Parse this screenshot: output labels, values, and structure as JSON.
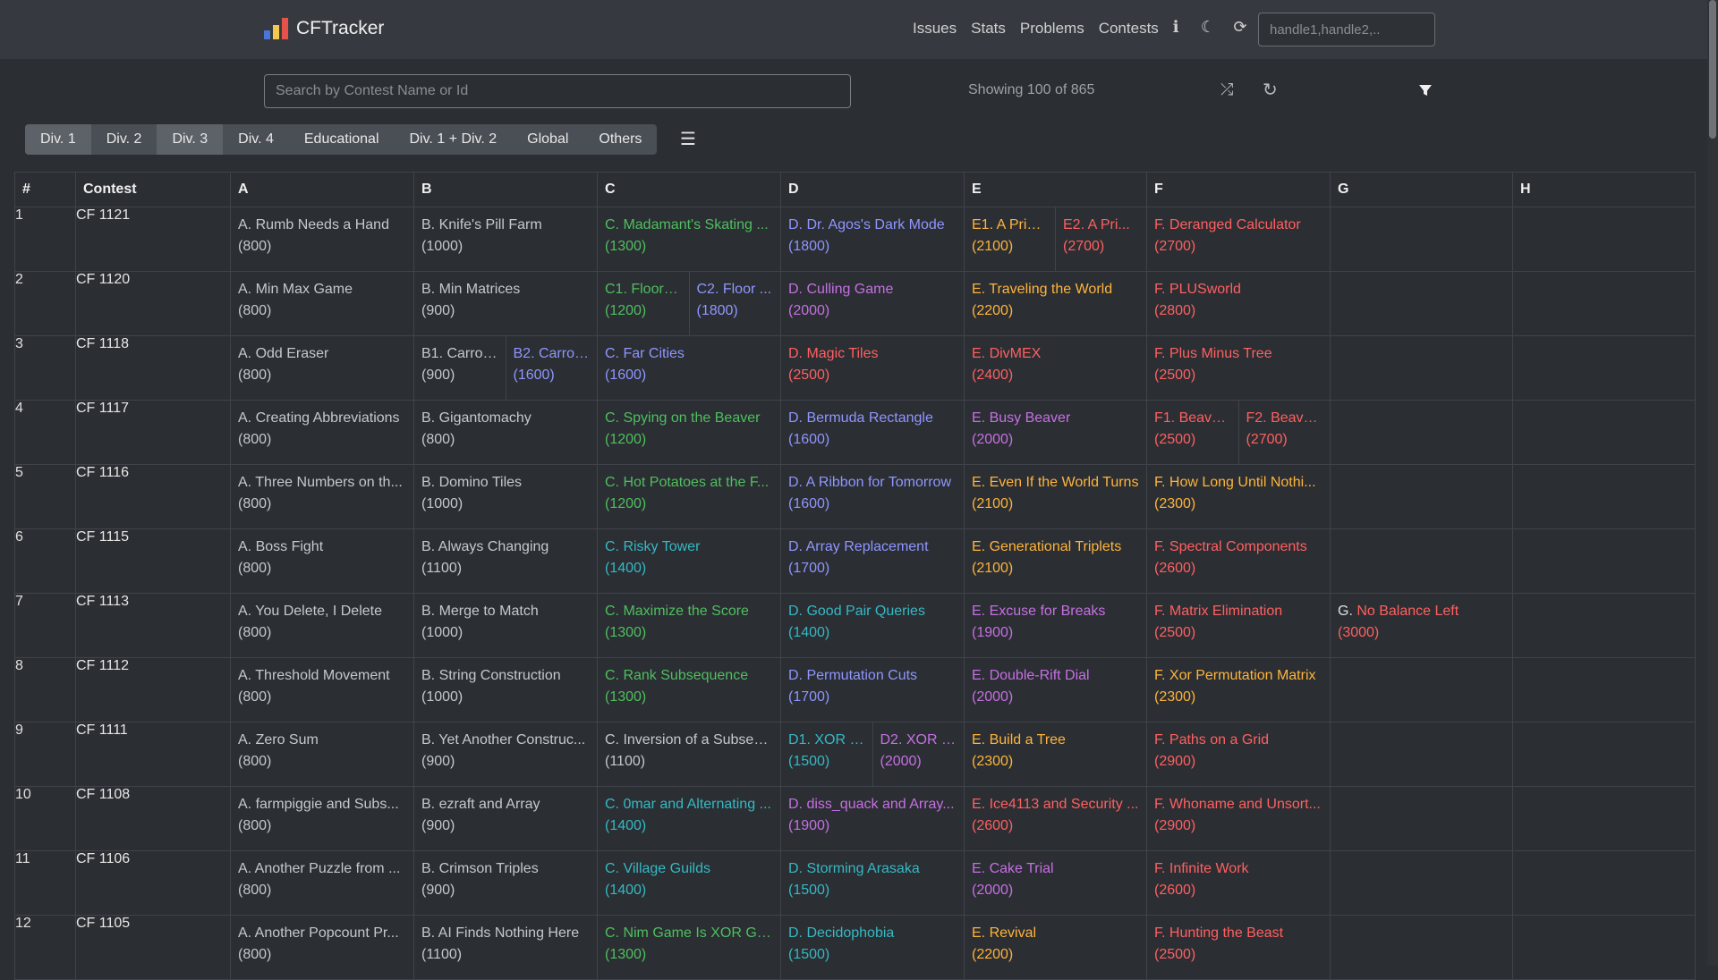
{
  "navbar": {
    "brand": "CFTracker",
    "links": [
      "Issues",
      "Stats",
      "Problems",
      "Contests"
    ],
    "handle_placeholder": "handle1,handle2,.."
  },
  "search": {
    "placeholder": "Search by Contest Name or Id",
    "showing": "Showing 100 of 865"
  },
  "tabs": [
    "Div. 1",
    "Div. 2",
    "Div. 3",
    "Div. 4",
    "Educational",
    "Div. 1 + Div. 2",
    "Global",
    "Others"
  ],
  "active_tabs": [
    0,
    2
  ],
  "table": {
    "headers": [
      "#",
      "Contest",
      "A",
      "B",
      "C",
      "D",
      "E",
      "F",
      "G",
      "H"
    ]
  },
  "colors": {
    "gray": "#c5c8cc",
    "green": "#4fbf5f",
    "cyan": "#35b9c4",
    "blue": "#8f96ff",
    "violet": "#c670e3",
    "orange": "#ffb43a",
    "red": "#ff6060"
  },
  "rows": [
    {
      "num": "1",
      "contest": "CF 1121",
      "cells": {
        "A": [
          {
            "name": "A. Rumb Needs a Hand",
            "rating": "(800)",
            "color": "gray"
          }
        ],
        "B": [
          {
            "name": "B. Knife's Pill Farm",
            "rating": "(1000)",
            "color": "gray"
          }
        ],
        "C": [
          {
            "name": "C. Madamant's Skating ...",
            "rating": "(1300)",
            "color": "green"
          }
        ],
        "D": [
          {
            "name": "D. Dr. Agos's Dark Mode",
            "rating": "(1800)",
            "color": "blue"
          }
        ],
        "E": [
          {
            "name": "E1. A Prim...",
            "rating": "(2100)",
            "color": "orange"
          },
          {
            "name": "E2. A Pri...",
            "rating": "(2700)",
            "color": "red"
          }
        ],
        "F": [
          {
            "name": "F. Deranged Calculator",
            "rating": "(2700)",
            "color": "red"
          }
        ],
        "G": [],
        "H": []
      }
    },
    {
      "num": "2",
      "contest": "CF 1120",
      "cells": {
        "A": [
          {
            "name": "A. Min Max Game",
            "rating": "(800)",
            "color": "gray"
          }
        ],
        "B": [
          {
            "name": "B. Min Matrices",
            "rating": "(900)",
            "color": "gray"
          }
        ],
        "C": [
          {
            "name": "C1. Floor o...",
            "rating": "(1200)",
            "color": "green"
          },
          {
            "name": "C2. Floor ...",
            "rating": "(1800)",
            "color": "blue"
          }
        ],
        "D": [
          {
            "name": "D. Culling Game",
            "rating": "(2000)",
            "color": "violet"
          }
        ],
        "E": [
          {
            "name": "E. Traveling the World",
            "rating": "(2200)",
            "color": "orange"
          }
        ],
        "F": [
          {
            "name": "F. PLUSworld",
            "rating": "(2800)",
            "color": "red"
          }
        ],
        "G": [],
        "H": []
      }
    },
    {
      "num": "3",
      "contest": "CF 1118",
      "cells": {
        "A": [
          {
            "name": "A. Odd Eraser",
            "rating": "(800)",
            "color": "gray"
          }
        ],
        "B": [
          {
            "name": "B1. Carrot ...",
            "rating": "(900)",
            "color": "gray"
          },
          {
            "name": "B2. Carrot...",
            "rating": "(1600)",
            "color": "blue"
          }
        ],
        "C": [
          {
            "name": "C. Far Cities",
            "rating": "(1600)",
            "color": "blue"
          }
        ],
        "D": [
          {
            "name": "D. Magic Tiles",
            "rating": "(2500)",
            "color": "red"
          }
        ],
        "E": [
          {
            "name": "E. DivMEX",
            "rating": "(2400)",
            "color": "red"
          }
        ],
        "F": [
          {
            "name": "F. Plus Minus Tree",
            "rating": "(2500)",
            "color": "red"
          }
        ],
        "G": [],
        "H": []
      }
    },
    {
      "num": "4",
      "contest": "CF 1117",
      "cells": {
        "A": [
          {
            "name": "A. Creating Abbreviations",
            "rating": "(800)",
            "color": "gray"
          }
        ],
        "B": [
          {
            "name": "B. Gigantomachy",
            "rating": "(800)",
            "color": "gray"
          }
        ],
        "C": [
          {
            "name": "C. Spying on the Beaver",
            "rating": "(1200)",
            "color": "green"
          }
        ],
        "D": [
          {
            "name": "D. Bermuda Rectangle",
            "rating": "(1600)",
            "color": "blue"
          }
        ],
        "E": [
          {
            "name": "E. Busy Beaver",
            "rating": "(2000)",
            "color": "violet"
          }
        ],
        "F": [
          {
            "name": "F1. Beaver'...",
            "rating": "(2500)",
            "color": "red"
          },
          {
            "name": "F2. Beave...",
            "rating": "(2700)",
            "color": "red"
          }
        ],
        "G": [],
        "H": []
      }
    },
    {
      "num": "5",
      "contest": "CF 1116",
      "cells": {
        "A": [
          {
            "name": "A. Three Numbers on th...",
            "rating": "(800)",
            "color": "gray"
          }
        ],
        "B": [
          {
            "name": "B. Domino Tiles",
            "rating": "(1000)",
            "color": "gray"
          }
        ],
        "C": [
          {
            "name": "C. Hot Potatoes at the F...",
            "rating": "(1200)",
            "color": "green"
          }
        ],
        "D": [
          {
            "name": "D. A Ribbon for Tomorrow",
            "rating": "(1600)",
            "color": "blue"
          }
        ],
        "E": [
          {
            "name": "E. Even If the World Turns",
            "rating": "(2100)",
            "color": "orange"
          }
        ],
        "F": [
          {
            "name": "F. How Long Until Nothi...",
            "rating": "(2300)",
            "color": "orange"
          }
        ],
        "G": [],
        "H": []
      }
    },
    {
      "num": "6",
      "contest": "CF 1115",
      "cells": {
        "A": [
          {
            "name": "A. Boss Fight",
            "rating": "(800)",
            "color": "gray"
          }
        ],
        "B": [
          {
            "name": "B. Always Changing",
            "rating": "(1100)",
            "color": "gray"
          }
        ],
        "C": [
          {
            "name": "C. Risky Tower",
            "rating": "(1400)",
            "color": "cyan"
          }
        ],
        "D": [
          {
            "name": "D. Array Replacement",
            "rating": "(1700)",
            "color": "blue"
          }
        ],
        "E": [
          {
            "name": "E. Generational Triplets",
            "rating": "(2100)",
            "color": "orange"
          }
        ],
        "F": [
          {
            "name": "F. Spectral Components",
            "rating": "(2600)",
            "color": "red"
          }
        ],
        "G": [],
        "H": []
      }
    },
    {
      "num": "7",
      "contest": "CF 1113",
      "cells": {
        "A": [
          {
            "name": "A. You Delete, I Delete",
            "rating": "(800)",
            "color": "gray"
          }
        ],
        "B": [
          {
            "name": "B. Merge to Match",
            "rating": "(1000)",
            "color": "gray"
          }
        ],
        "C": [
          {
            "name": "C. Maximize the Score",
            "rating": "(1300)",
            "color": "green"
          }
        ],
        "D": [
          {
            "name": "D. Good Pair Queries",
            "rating": "(1400)",
            "color": "cyan"
          }
        ],
        "E": [
          {
            "name": "E. Excuse for Breaks",
            "rating": "(1900)",
            "color": "violet"
          }
        ],
        "F": [
          {
            "name": "F. Matrix Elimination",
            "rating": "(2500)",
            "color": "red"
          }
        ],
        "G": [
          {
            "prefix": "G.",
            "name": " No Balance Left",
            "rating": "(3000)",
            "color": "red"
          }
        ],
        "H": []
      }
    },
    {
      "num": "8",
      "contest": "CF 1112",
      "cells": {
        "A": [
          {
            "name": "A. Threshold Movement",
            "rating": "(800)",
            "color": "gray"
          }
        ],
        "B": [
          {
            "name": "B. String Construction",
            "rating": "(1000)",
            "color": "gray"
          }
        ],
        "C": [
          {
            "name": "C. Rank Subsequence",
            "rating": "(1300)",
            "color": "green"
          }
        ],
        "D": [
          {
            "name": "D. Permutation Cuts",
            "rating": "(1700)",
            "color": "blue"
          }
        ],
        "E": [
          {
            "name": "E. Double-Rift Dial",
            "rating": "(2000)",
            "color": "violet"
          }
        ],
        "F": [
          {
            "name": "F. Xor Permutation Matrix",
            "rating": "(2300)",
            "color": "orange"
          }
        ],
        "G": [],
        "H": []
      }
    },
    {
      "num": "9",
      "contest": "CF 1111",
      "cells": {
        "A": [
          {
            "name": "A. Zero Sum",
            "rating": "(800)",
            "color": "gray"
          }
        ],
        "B": [
          {
            "name": "B. Yet Another Construc...",
            "rating": "(900)",
            "color": "gray"
          }
        ],
        "C": [
          {
            "name": "C. Inversion of a Subseq...",
            "rating": "(1100)",
            "color": "gray"
          }
        ],
        "D": [
          {
            "name": "D1. XOR S...",
            "rating": "(1500)",
            "color": "cyan"
          },
          {
            "name": "D2. XOR S...",
            "rating": "(2000)",
            "color": "violet"
          }
        ],
        "E": [
          {
            "name": "E. Build a Tree",
            "rating": "(2300)",
            "color": "orange"
          }
        ],
        "F": [
          {
            "name": "F. Paths on a Grid",
            "rating": "(2900)",
            "color": "red"
          }
        ],
        "G": [],
        "H": []
      }
    },
    {
      "num": "10",
      "contest": "CF 1108",
      "cells": {
        "A": [
          {
            "name": "A. farmpiggie and Subs...",
            "rating": "(800)",
            "color": "gray"
          }
        ],
        "B": [
          {
            "name": "B. ezraft and Array",
            "rating": "(900)",
            "color": "gray"
          }
        ],
        "C": [
          {
            "name": "C. 0mar and Alternating ...",
            "rating": "(1400)",
            "color": "cyan"
          }
        ],
        "D": [
          {
            "name": "D. diss_quack and Array...",
            "rating": "(1900)",
            "color": "violet"
          }
        ],
        "E": [
          {
            "name": "E. Ice4113 and Security ...",
            "rating": "(2600)",
            "color": "red"
          }
        ],
        "F": [
          {
            "name": "F. Whoname and Unsort...",
            "rating": "(2900)",
            "color": "red"
          }
        ],
        "G": [],
        "H": []
      }
    },
    {
      "num": "11",
      "contest": "CF 1106",
      "cells": {
        "A": [
          {
            "name": "A. Another Puzzle from ...",
            "rating": "(800)",
            "color": "gray"
          }
        ],
        "B": [
          {
            "name": "B. Crimson Triples",
            "rating": "(900)",
            "color": "gray"
          }
        ],
        "C": [
          {
            "name": "C. Village Guilds",
            "rating": "(1400)",
            "color": "cyan"
          }
        ],
        "D": [
          {
            "name": "D. Storming Arasaka",
            "rating": "(1500)",
            "color": "cyan"
          }
        ],
        "E": [
          {
            "name": "E. Cake Trial",
            "rating": "(2000)",
            "color": "violet"
          }
        ],
        "F": [
          {
            "name": "F. Infinite Work",
            "rating": "(2600)",
            "color": "red"
          }
        ],
        "G": [],
        "H": []
      }
    },
    {
      "num": "12",
      "contest": "CF 1105",
      "cells": {
        "A": [
          {
            "name": "A. Another Popcount Pr...",
            "rating": "(800)",
            "color": "gray"
          }
        ],
        "B": [
          {
            "name": "B. AI Finds Nothing Here",
            "rating": "(1100)",
            "color": "gray"
          }
        ],
        "C": [
          {
            "name": "C. Nim Game Is XOR Ga...",
            "rating": "(1300)",
            "color": "green"
          }
        ],
        "D": [
          {
            "name": "D. Decidophobia",
            "rating": "(1500)",
            "color": "cyan"
          }
        ],
        "E": [
          {
            "name": "E. Revival",
            "rating": "(2200)",
            "color": "orange"
          }
        ],
        "F": [
          {
            "name": "F. Hunting the Beast",
            "rating": "(2500)",
            "color": "red"
          }
        ],
        "G": [],
        "H": []
      }
    }
  ]
}
